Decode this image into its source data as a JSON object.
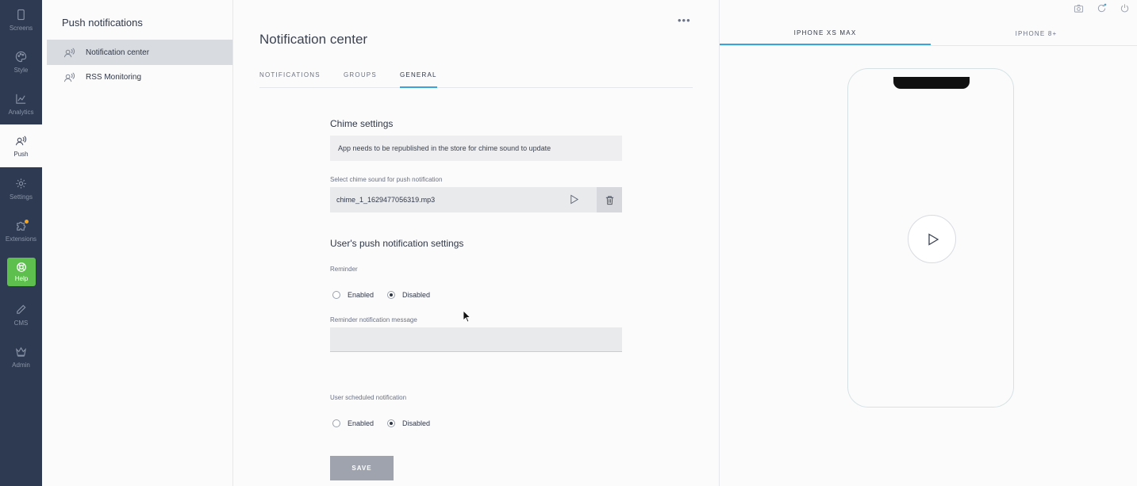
{
  "rail": {
    "items": [
      {
        "label": "Screens",
        "icon": "phone-icon"
      },
      {
        "label": "Style",
        "icon": "palette-icon"
      },
      {
        "label": "Analytics",
        "icon": "chart-line-icon"
      },
      {
        "label": "Push",
        "icon": "push-icon",
        "active": true
      },
      {
        "label": "Settings",
        "icon": "gear-icon"
      },
      {
        "label": "Extensions",
        "icon": "puzzle-icon",
        "badge": true
      },
      {
        "label": "Help",
        "icon": "lifebuoy-icon"
      },
      {
        "label": "CMS",
        "icon": "pencil-icon"
      },
      {
        "label": "Admin",
        "icon": "crown-icon"
      }
    ],
    "accent": "#5ebf4f"
  },
  "subnav": {
    "title": "Push notifications",
    "items": [
      {
        "label": "Notification center",
        "selected": true
      },
      {
        "label": "RSS Monitoring",
        "selected": false
      }
    ]
  },
  "main": {
    "more_label": "•••",
    "title": "Notification center",
    "tabs": [
      {
        "label": "NOTIFICATIONS"
      },
      {
        "label": "GROUPS"
      },
      {
        "label": "GENERAL",
        "active": true
      }
    ],
    "chime": {
      "title": "Chime settings",
      "info": "App needs to be republished in the store for chime sound to update",
      "select_label": "Select chime sound for push notification",
      "file": "chime_1_1629477056319.mp3"
    },
    "user_settings": {
      "title": "User's push notification settings",
      "reminder_label": "Reminder",
      "reminder_options": [
        "Enabled",
        "Disabled"
      ],
      "reminder_selected": "Disabled",
      "reminder_message_label": "Reminder notification message",
      "reminder_message_value": "",
      "scheduled_label": "User scheduled notification",
      "scheduled_options": [
        "Enabled",
        "Disabled"
      ],
      "scheduled_selected": "Disabled"
    },
    "save_label": "SAVE"
  },
  "preview": {
    "device_tabs": [
      {
        "label": "IPHONE XS MAX",
        "active": true
      },
      {
        "label": "IPHONE 8+"
      }
    ],
    "top_icons": [
      "camera-icon",
      "refresh-icon",
      "power-icon"
    ]
  }
}
